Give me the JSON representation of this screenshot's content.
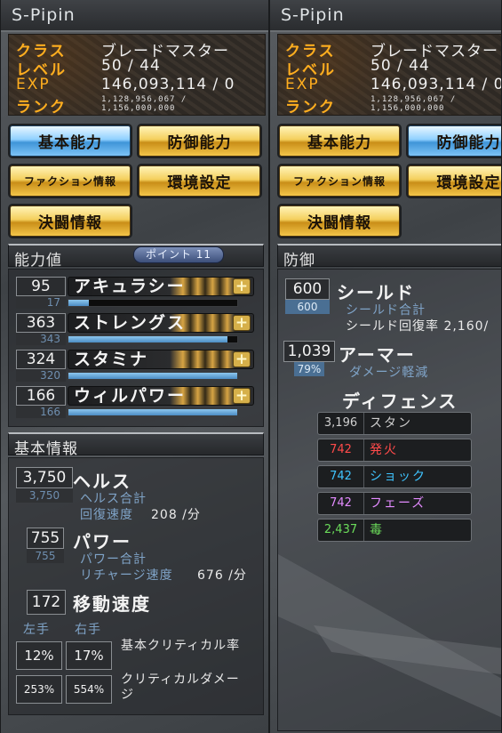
{
  "character": {
    "name": "S-Pipin",
    "class_label": "クラス",
    "class_value": "ブレードマスター",
    "level_label": "レベル",
    "level_value": "50 / 44",
    "exp_label": "EXP",
    "exp_value": "146,093,114 / 0",
    "rank_label": "ランク",
    "rank_value": "1,128,956,067 / 1,156,000,000"
  },
  "buttons": {
    "basic": "基本能力",
    "defense": "防御能力",
    "faction": "ファクション情報",
    "settings": "環境設定",
    "duel": "決闘情報"
  },
  "abilities": {
    "header": "能力値",
    "points": "ポイント 11",
    "stats": [
      {
        "value": "95",
        "base": "17",
        "name": "アキュラシー",
        "fill": 0.12
      },
      {
        "value": "363",
        "base": "343",
        "name": "ストレングス",
        "fill": 0.94
      },
      {
        "value": "324",
        "base": "320",
        "name": "スタミナ",
        "fill": 1.0
      },
      {
        "value": "166",
        "base": "166",
        "name": "ウィルパワー",
        "fill": 1.0
      }
    ]
  },
  "basic_info": {
    "header": "基本情報",
    "health_value": "3,750",
    "health_base": "3,750",
    "health_name": "ヘルス",
    "health_total": "ヘルス合計",
    "regen_label": "回復速度",
    "regen_value": "208 /分",
    "power_value": "755",
    "power_base": "755",
    "power_name": "パワー",
    "power_total": "パワー合計",
    "recharge_label": "リチャージ速度",
    "recharge_value": "676 /分",
    "speed_value": "172",
    "speed_name": "移動速度",
    "left_hand": "左手",
    "right_hand": "右手",
    "crit_left": "12%",
    "crit_right": "17%",
    "crit_label": "基本クリティカル率",
    "critdmg_left": "253%",
    "critdmg_right": "554%",
    "critdmg_label": "クリティカルダメージ"
  },
  "defense": {
    "header": "防御",
    "shield_value": "600",
    "shield_base": "600",
    "shield_name": "シールド",
    "shield_total": "シールド合計",
    "shield_regen": "シールド回復率 2,160/",
    "armor_value": "1,039",
    "armor_pct": "79%",
    "armor_name": "アーマー",
    "armor_reduction": "ダメージ軽減",
    "defense_name": "ディフェンス",
    "resists": [
      {
        "value": "3,196",
        "name": "スタン",
        "color": "#cfcfcf"
      },
      {
        "value": "742",
        "name": "発火",
        "color": "#ff4a4a"
      },
      {
        "value": "742",
        "name": "ショック",
        "color": "#3fc4ff"
      },
      {
        "value": "742",
        "name": "フェーズ",
        "color": "#e38bff"
      },
      {
        "value": "2,437",
        "name": "毒",
        "color": "#6bdc5a"
      }
    ]
  }
}
